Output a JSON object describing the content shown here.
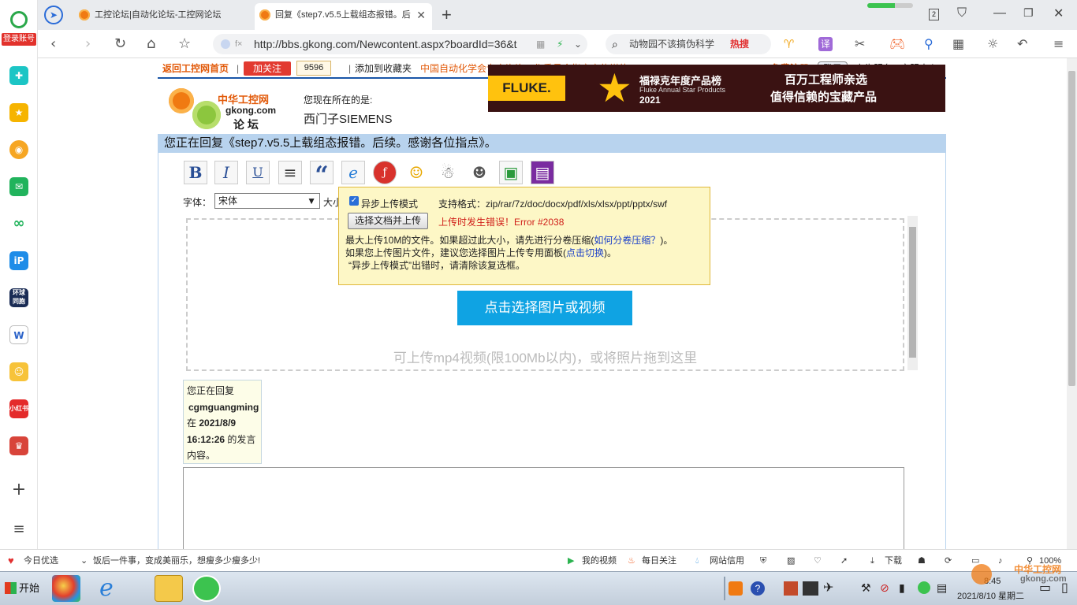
{
  "sidebar": {
    "login": "登录账号"
  },
  "tabs": [
    {
      "label": "工控论坛|自动化论坛-工控网论坛"
    },
    {
      "label": "回复《step7.v5.5上载组态报错。后"
    }
  ],
  "address": {
    "url": "http://bbs.gkong.com/Newcontent.aspx?boardId=36&t"
  },
  "search": {
    "text": "动物园不该搞伪科学",
    "hot": "热搜"
  },
  "topbar": {
    "home": "返回工控网首页",
    "follow": "加关注",
    "count": "9596",
    "bookmark": "添加到收藏夹",
    "slogan": "中国自动化学会专家咨询工作委员会指定宣传媒体",
    "register": "免费注册",
    "login": "登录",
    "ad": "广告服务",
    "service": "客服中心"
  },
  "header": {
    "logo_cn": "中华工控网",
    "logo_domain": "gkong.com",
    "logo_forum": "论 坛",
    "location_label": "您现在所在的是:",
    "location": "西门子SIEMENS",
    "banner_brand": "FLUKE.",
    "banner_title": "福禄克年度产品榜",
    "banner_sub": "Fluke Annual Star Products",
    "banner_year": "2021",
    "banner_right1": "百万工程师亲选",
    "banner_right2": "值得信赖的宝藏产品"
  },
  "reply_title": "您正在回复《step7.v5.5上载组态报错。后续。感谢各位指点》。",
  "toolbar": {
    "bold": "B",
    "italic": "I",
    "underline": "U",
    "quote": "“"
  },
  "font": {
    "label": "字体：",
    "value": "宋体",
    "size_label": "大小"
  },
  "upload": {
    "button": "点击选择图片或视频",
    "hint": "可上传mp4视频(限100Mb以内)，或将照片拖到这里"
  },
  "popup": {
    "async_label": "异步上传模式",
    "formats": "支持格式：zip/rar/7z/doc/docx/pdf/xls/xlsx/ppt/pptx/swf",
    "choose_btn": "选择文档并上传",
    "error": "上传时发生错误！Error #2038",
    "line1_a": "最大上传10M的文件。如果超过此大小，请先进行分卷压缩(",
    "line1_link": "如何分卷压缩？",
    "line1_b": ")。",
    "line2_a": "如果您上传图片文件，建议您选择图片上传专用面板(",
    "line2_link": "点击切换",
    "line2_b": ")。",
    "line3": "“异步上传模式”出错时，请清除该复选框。"
  },
  "quote": {
    "prefix": "您正在回复",
    "user": "cgmguangming",
    "at": "在",
    "date": "2021/8/9",
    "time": "16:12:26",
    "suffix": "的发言内容。"
  },
  "statusbar": {
    "left1": "今日优选",
    "left2": "饭后一件事，变成美丽乐，想瘦多少瘦多少!",
    "video": "我的视频",
    "daily": "每日关注",
    "credit": "网站信用",
    "download": "下载",
    "zoom": "100%"
  },
  "taskbar": {
    "start": "开始",
    "date": "2021/8/10 星期二",
    "time": "8:45",
    "watermark_cn": "中华工控网",
    "watermark_en": "gkong.com"
  }
}
